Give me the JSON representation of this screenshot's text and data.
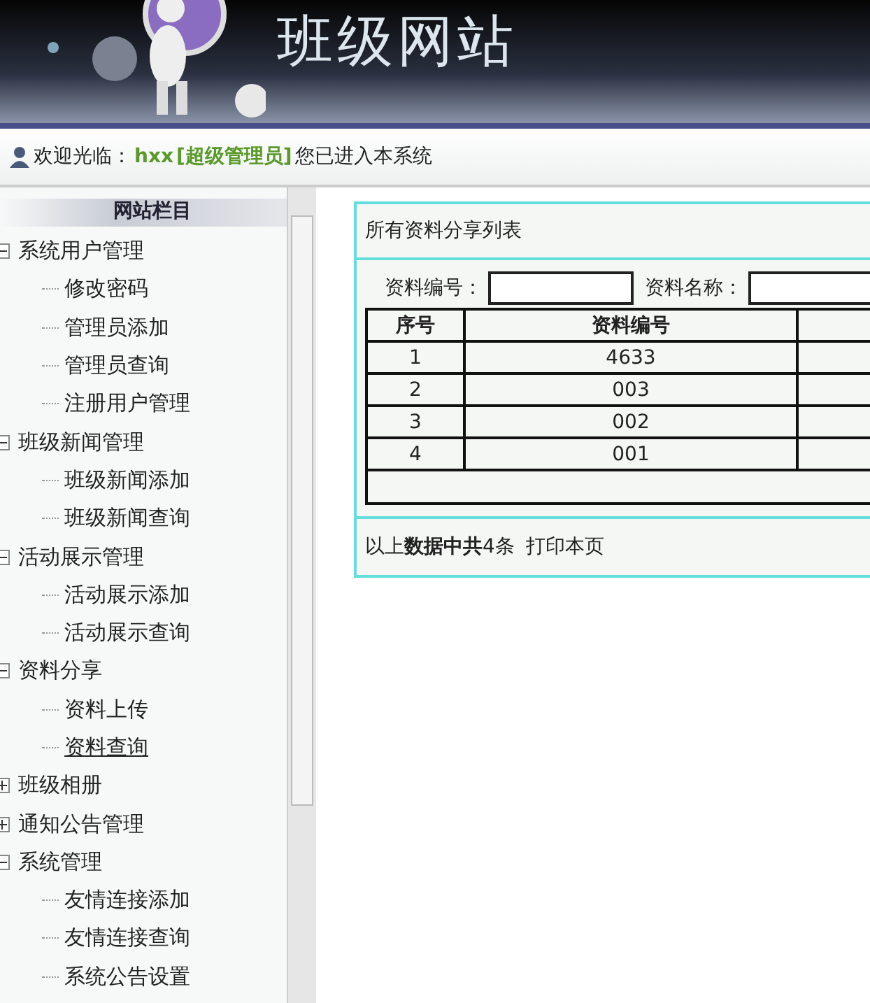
{
  "header": {
    "title": "班级网站"
  },
  "welcome": {
    "label": "欢迎光临：",
    "user": "hxx",
    "role": "[超级管理员]",
    "message": "您已进入本系统"
  },
  "sidebar": {
    "title": "网站栏目",
    "groups": [
      {
        "label": "系统用户管理",
        "expanded": true,
        "children": [
          {
            "label": "修改密码",
            "selected": false
          },
          {
            "label": "管理员添加",
            "selected": false
          },
          {
            "label": "管理员查询",
            "selected": false
          },
          {
            "label": "注册用户管理",
            "selected": false
          }
        ]
      },
      {
        "label": "班级新闻管理",
        "expanded": true,
        "children": [
          {
            "label": "班级新闻添加",
            "selected": false
          },
          {
            "label": "班级新闻查询",
            "selected": false
          }
        ]
      },
      {
        "label": "活动展示管理",
        "expanded": true,
        "children": [
          {
            "label": "活动展示添加",
            "selected": false
          },
          {
            "label": "活动展示查询",
            "selected": false
          }
        ]
      },
      {
        "label": "资料分享",
        "expanded": true,
        "children": [
          {
            "label": "资料上传",
            "selected": false
          },
          {
            "label": "资料查询",
            "selected": true
          }
        ]
      },
      {
        "label": "班级相册",
        "expanded": false
      },
      {
        "label": "通知公告管理",
        "expanded": false
      },
      {
        "label": "系统管理",
        "expanded": true,
        "children": [
          {
            "label": "友情连接添加",
            "selected": false
          },
          {
            "label": "友情连接查询",
            "selected": false
          },
          {
            "label": "系统公告设置",
            "selected": false
          }
        ]
      }
    ]
  },
  "panel": {
    "title": "所有资料分享列表",
    "search": [
      {
        "label": "资料编号："
      },
      {
        "label": "资料名称："
      }
    ],
    "table": {
      "columns": [
        "序号",
        "资料编号"
      ],
      "rows": [
        [
          "1",
          "4633"
        ],
        [
          "2",
          "003"
        ],
        [
          "3",
          "002"
        ],
        [
          "4",
          "001"
        ]
      ]
    },
    "summary": "以上**数据中共**4条",
    "print_link": "打印本页"
  }
}
